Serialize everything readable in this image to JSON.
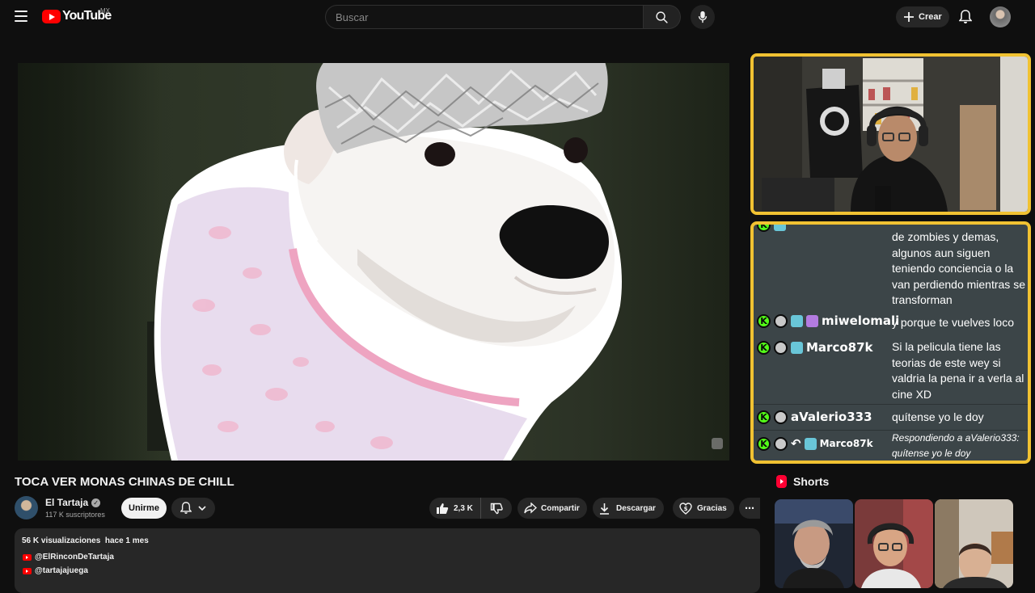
{
  "header": {
    "logo_text": "YouTube",
    "country": "MX",
    "search_placeholder": "Buscar",
    "create_label": "Crear"
  },
  "video": {
    "title": "TOCA VER MONAS CHINAS DE CHILL"
  },
  "channel": {
    "name": "El Tartaja",
    "subscribers": "117 K suscriptores",
    "join_label": "Unirme"
  },
  "actions": {
    "likes": "2,3 K",
    "share_label": "Compartir",
    "download_label": "Descargar",
    "thanks_label": "Gracias"
  },
  "description": {
    "views": "56 K visualizaciones",
    "date": "hace 1 mes",
    "links": [
      "@ElRinconDeTartaja",
      "@tartajajuega"
    ]
  },
  "stream_chat": {
    "messages": [
      {
        "user": "",
        "text": "de zombies y demas, algunos aun siguen teniendo conciencia o la van perdiendo mientras se transforman"
      },
      {
        "user": "miwelomali",
        "text": "y porque te vuelves loco"
      },
      {
        "user": "Marco87k",
        "text": "Si la pelicula tiene las teorias de este wey si valdria la pena ir a verla al cine XD"
      },
      {
        "user": "aValerio333",
        "text": "quítense yo le doy"
      },
      {
        "user": "Marco87k",
        "text": "Respondiendo a aValerio333: quítense yo le doy",
        "reply": true
      }
    ],
    "badge_letter": "K"
  },
  "shorts": {
    "heading": "Shorts"
  },
  "colors": {
    "background": "#0f0f0f",
    "overlay_border": "#f1c232",
    "kick_green": "#53fc18",
    "youtube_red": "#ff0000"
  }
}
